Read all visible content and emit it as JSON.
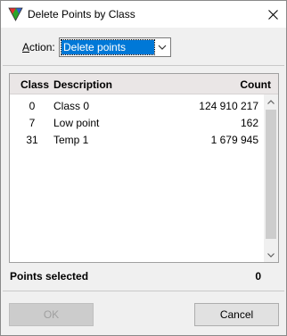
{
  "window": {
    "title": "Delete Points by Class",
    "close_icon": "close-icon"
  },
  "action": {
    "label_prefix": "",
    "label_accel": "A",
    "label_rest": "ction:",
    "selected": "Delete points"
  },
  "list": {
    "headers": {
      "class": "Class",
      "description": "Description",
      "count": "Count"
    },
    "rows": [
      {
        "class": "0",
        "description": "Class 0",
        "count": "124 910 217"
      },
      {
        "class": "7",
        "description": "Low point",
        "count": "162"
      },
      {
        "class": "31",
        "description": "Temp 1",
        "count": "1 679 945"
      }
    ]
  },
  "summary": {
    "label": "Points selected",
    "value": "0"
  },
  "buttons": {
    "ok": "OK",
    "cancel": "Cancel"
  },
  "colors": {
    "selection": "#0078d7",
    "header_bg": "#eae6e6",
    "dialog_bg": "#f0f0f0"
  }
}
